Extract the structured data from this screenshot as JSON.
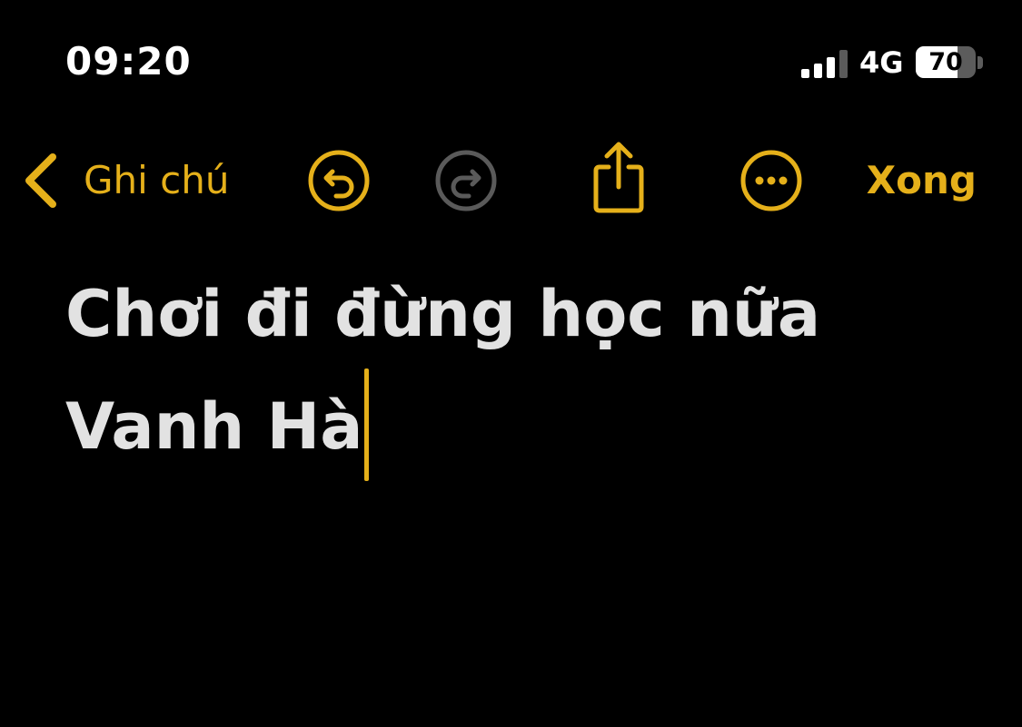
{
  "status_bar": {
    "time": "09:20",
    "network": "4G",
    "battery_level": "70",
    "battery_fraction": 0.7,
    "signal_bars_active": 3,
    "signal_bars_total": 4
  },
  "toolbar": {
    "back_label": "Ghi chú",
    "done_label": "Xong",
    "icons": [
      "chevron-left-icon",
      "undo-icon",
      "redo-icon",
      "share-icon",
      "more-icon"
    ]
  },
  "note": {
    "lines": [
      "Chơi đi đừng học nữa",
      "Vanh Hà"
    ]
  },
  "colors": {
    "accent": "#e5b01a",
    "background": "#000000",
    "text": "#e2e2e2",
    "disabled": "#5a5a5a"
  }
}
